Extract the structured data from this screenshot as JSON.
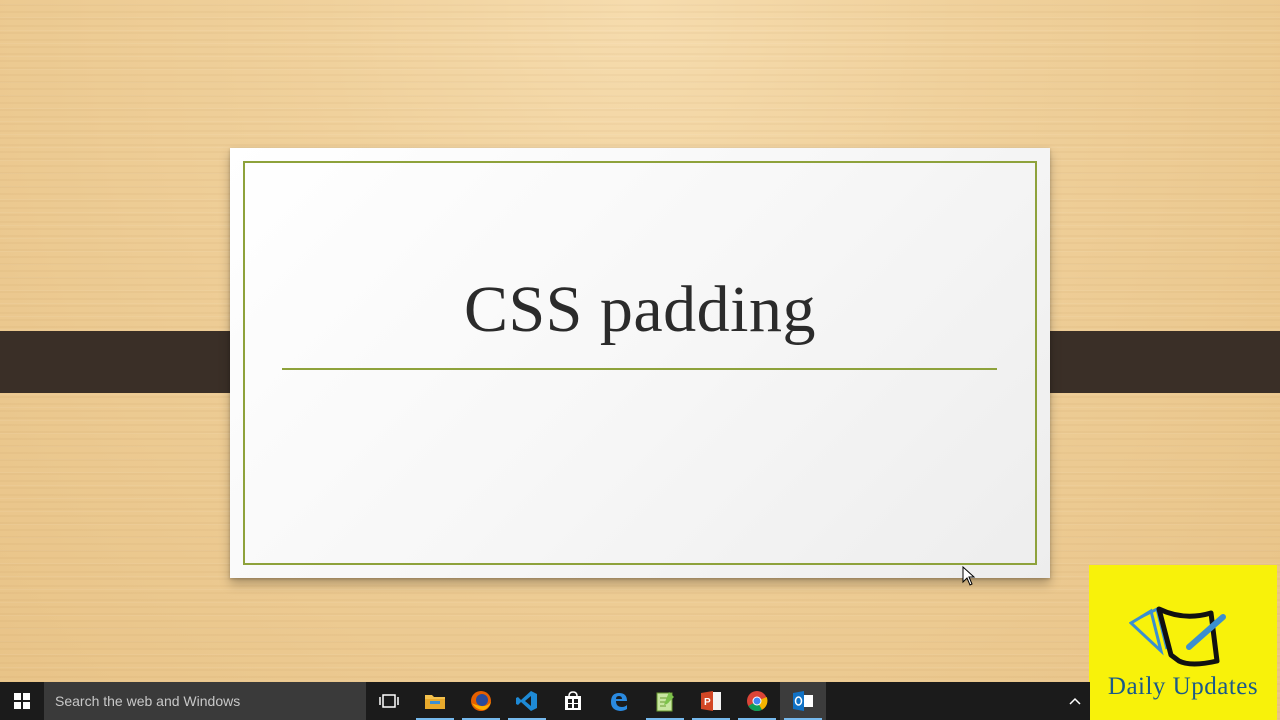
{
  "slide": {
    "title": "CSS padding"
  },
  "watermark": {
    "text": "Daily Updates",
    "background": "#f8f20a",
    "text_color": "#1a5a8a"
  },
  "taskbar": {
    "search_placeholder": "Search the web and Windows",
    "icons": [
      "windows-start-icon",
      "task-view-icon",
      "file-explorer-icon",
      "firefox-icon",
      "vscode-icon",
      "store-icon",
      "edge-icon",
      "notepad-plus-icon",
      "powerpoint-icon",
      "chrome-icon",
      "outlook-icon"
    ]
  },
  "colors": {
    "accent_green": "#8ea23b",
    "band": "#3a2f27",
    "taskbar": "#1b1b1b"
  }
}
